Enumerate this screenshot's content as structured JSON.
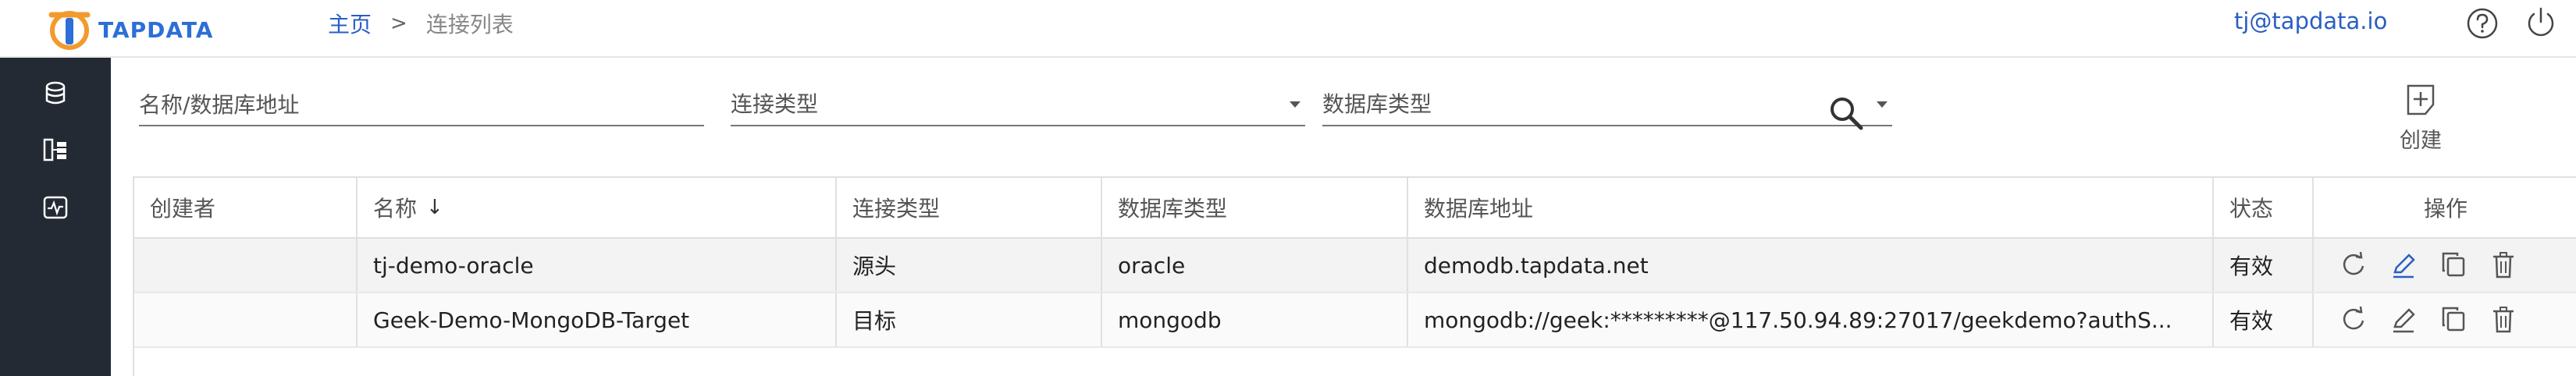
{
  "app": {
    "logo_text": "TAPDATA",
    "accent_color": "#2a5ec4",
    "logo_orange": "#f29a2e"
  },
  "breadcrumb": {
    "home": "主页",
    "separator": ">",
    "current": "连接列表"
  },
  "header": {
    "user_email": "tj@tapdata.io",
    "help_icon": "help-circle-icon",
    "power_icon": "power-icon"
  },
  "sidebar": {
    "items": [
      {
        "icon": "database-icon"
      },
      {
        "icon": "data-flow-icon"
      },
      {
        "icon": "monitor-icon"
      }
    ]
  },
  "filters": {
    "name_placeholder": "名称/数据库地址",
    "connection_type_label": "连接类型",
    "database_type_label": "数据库类型",
    "search_icon": "search-icon",
    "create_label": "创建"
  },
  "table": {
    "columns": [
      "创建者",
      "名称",
      "连接类型",
      "数据库类型",
      "数据库地址",
      "状态",
      "操作"
    ],
    "sort_indicator": "↓",
    "rows": [
      {
        "creator": "",
        "name": "tj-demo-oracle",
        "connection_type": "源头",
        "database_type": "oracle",
        "address": "demodb.tapdata.net",
        "status": "有效"
      },
      {
        "creator": "",
        "name": "Geek-Demo-MongoDB-Target",
        "connection_type": "目标",
        "database_type": "mongodb",
        "address": "mongodb://geek:*********@117.50.94.89:27017/geekdemo?authS...",
        "status": "有效"
      }
    ],
    "actions": [
      "refresh-icon",
      "edit-icon",
      "copy-icon",
      "delete-icon"
    ]
  }
}
